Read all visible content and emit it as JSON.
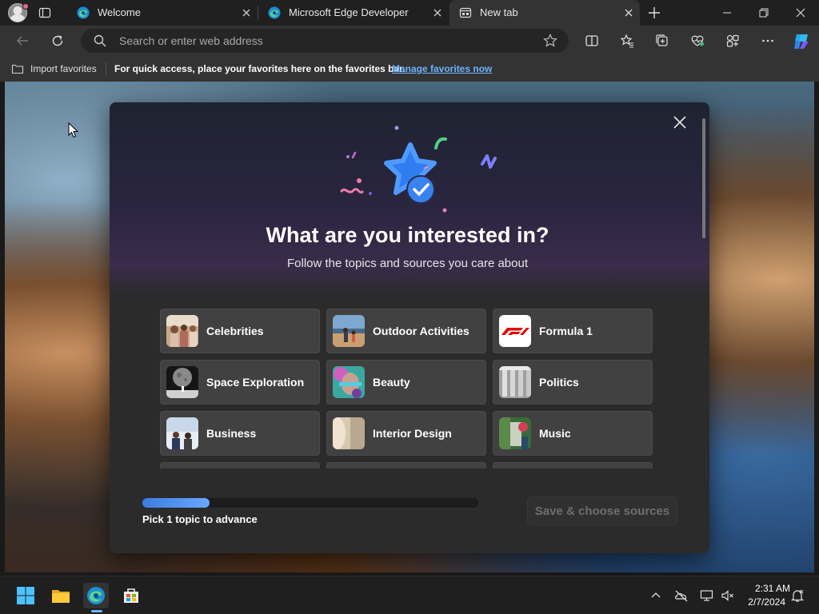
{
  "tabs": [
    {
      "title": "Welcome",
      "icon": "edge-icon",
      "active": false
    },
    {
      "title": "Microsoft Edge Developer",
      "icon": "edge-icon",
      "active": false
    },
    {
      "title": "New tab",
      "icon": "newtab-page-icon",
      "active": true
    }
  ],
  "toolbar": {
    "address_placeholder": "Search or enter web address"
  },
  "favorites_bar": {
    "import_label": "Import favorites",
    "hint": "For quick access, place your favorites here on the favorites bar.",
    "manage_link": "Manage favorites now"
  },
  "modal": {
    "title": "What are you interested in?",
    "subtitle": "Follow the topics and sources you care about",
    "topics": [
      {
        "label": "Celebrities",
        "icon": "celebrities-thumb"
      },
      {
        "label": "Outdoor Activities",
        "icon": "outdoor-activities-thumb"
      },
      {
        "label": "Formula 1",
        "icon": "formula-1-logo"
      },
      {
        "label": "Space Exploration",
        "icon": "space-exploration-thumb"
      },
      {
        "label": "Beauty",
        "icon": "beauty-thumb"
      },
      {
        "label": "Politics",
        "icon": "politics-thumb"
      },
      {
        "label": "Business",
        "icon": "business-thumb"
      },
      {
        "label": "Interior Design",
        "icon": "interior-design-thumb"
      },
      {
        "label": "Music",
        "icon": "music-thumb"
      }
    ],
    "progress_fraction": 0.2,
    "progress_text": "Pick 1 topic to advance",
    "save_button": "Save & choose sources"
  },
  "taskbar": {
    "apps": [
      "start-icon",
      "file-explorer-icon",
      "edge-icon",
      "microsoft-store-icon"
    ],
    "time": "2:31 AM",
    "date": "2/7/2024"
  },
  "colors": {
    "accent": "#6cb4ff",
    "progress": "#4a8ff0",
    "f1_red": "#e10600"
  }
}
